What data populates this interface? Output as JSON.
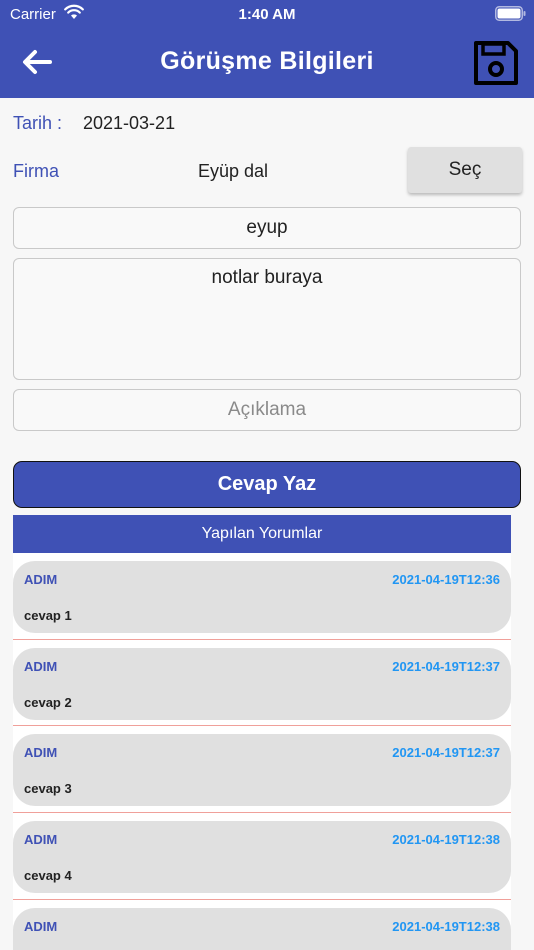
{
  "status_bar": {
    "carrier": "Carrier",
    "time": "1:40 AM"
  },
  "header": {
    "title": "Görüşme Bilgileri",
    "back_icon": "arrow-left-icon",
    "save_icon": "floppy-disk-icon"
  },
  "form": {
    "date_label": "Tarih :",
    "date_value": "2021-03-21",
    "company_label": "Firma",
    "company_value": "Eyüp dal",
    "select_button": "Seç",
    "name_value": "eyup",
    "notes_value": "notlar buraya",
    "description_placeholder": "Açıklama",
    "reply_button": "Cevap Yaz"
  },
  "comments": {
    "header": "Yapılan Yorumlar",
    "items": [
      {
        "author": "ADIM",
        "date": "2021-04-19T12:36",
        "text": "cevap 1"
      },
      {
        "author": "ADIM",
        "date": "2021-04-19T12:37",
        "text": "cevap 2"
      },
      {
        "author": "ADIM",
        "date": "2021-04-19T12:37",
        "text": "cevap 3"
      },
      {
        "author": "ADIM",
        "date": "2021-04-19T12:38",
        "text": "cevap 4"
      },
      {
        "author": "ADIM",
        "date": "2021-04-19T12:38",
        "text": ""
      }
    ]
  },
  "colors": {
    "primary": "#3f51b5",
    "date_blue": "#2196f3",
    "bubble": "#e0e0e0",
    "divider": "#f0a09a"
  }
}
